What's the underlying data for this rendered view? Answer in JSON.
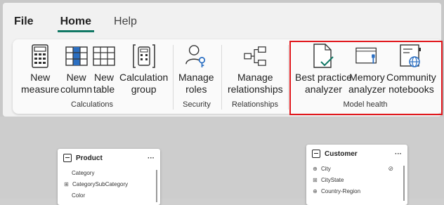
{
  "menu": {
    "file": "File",
    "home": "Home",
    "help": "Help"
  },
  "ribbon": {
    "calculations": {
      "label": "Calculations",
      "buttons": [
        {
          "label": "New\nmeasure"
        },
        {
          "label": "New\ncolumn"
        },
        {
          "label": "New\ntable"
        },
        {
          "label": "Calculation\ngroup"
        }
      ]
    },
    "security": {
      "label": "Security",
      "buttons": [
        {
          "label": "Manage\nroles"
        }
      ]
    },
    "relationships": {
      "label": "Relationships",
      "buttons": [
        {
          "label": "Manage\nrelationships"
        }
      ]
    },
    "model_health": {
      "label": "Model health",
      "buttons": [
        {
          "label": "Best practice\nanalyzer"
        },
        {
          "label": "Memory\nanalyzer"
        },
        {
          "label": "Community\nnotebooks"
        }
      ]
    }
  },
  "canvas": {
    "product": {
      "title": "Product",
      "menu": "···",
      "fields": [
        "Category",
        "CategorySubCategory",
        "Color"
      ]
    },
    "customer": {
      "title": "Customer",
      "menu": "···",
      "fields": [
        "City",
        "CityState",
        "Country-Region"
      ]
    }
  },
  "colors": {
    "accent": "#117865",
    "highlight": "#e0161b",
    "blue": "#2b6fc2"
  }
}
